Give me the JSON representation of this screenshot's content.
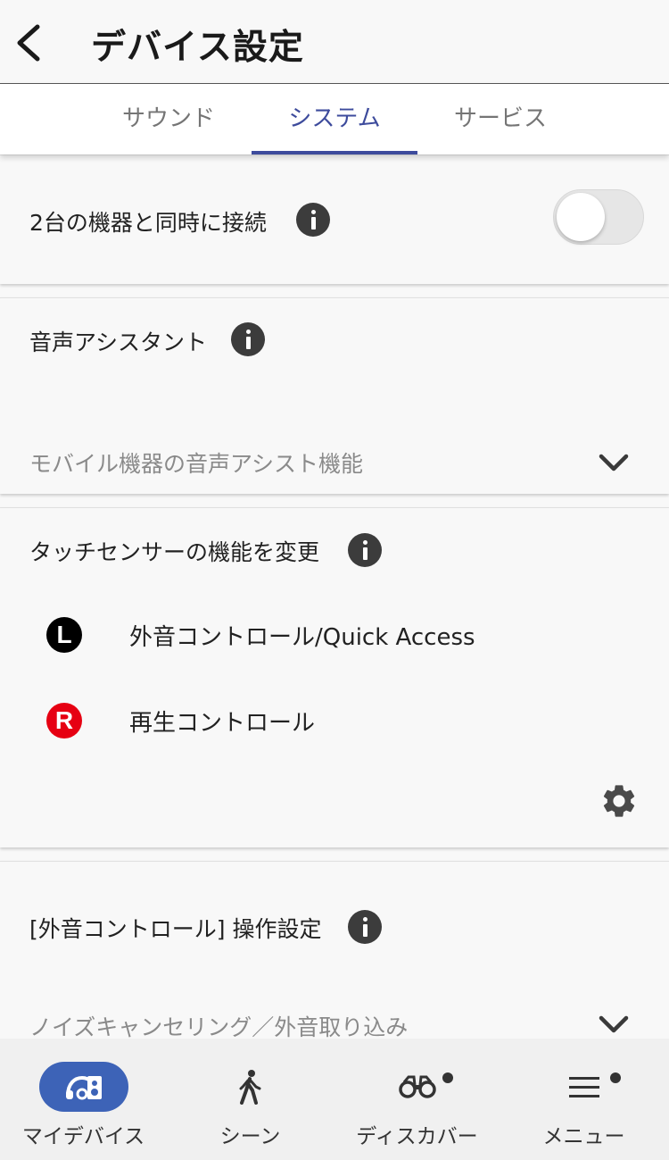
{
  "header": {
    "title": "デバイス設定",
    "back_icon": "chevron-left-icon"
  },
  "tabs": [
    {
      "label": "サウンド",
      "active": false
    },
    {
      "label": "システム",
      "active": true
    },
    {
      "label": "サービス",
      "active": false
    }
  ],
  "sections": {
    "multipoint": {
      "label": "2台の機器と同時に接続",
      "toggle_on": false
    },
    "voice_assistant": {
      "label": "音声アシスタント",
      "selected_value": "モバイル機器の音声アシスト機能"
    },
    "touch_sensor": {
      "label": "タッチセンサーの機能を変更",
      "rows": [
        {
          "badge": "L",
          "text": "外音コントロール/Quick Access"
        },
        {
          "badge": "R",
          "text": "再生コントロール"
        }
      ]
    },
    "ambient_control": {
      "label": "[外音コントロール] 操作設定",
      "selected_value": "ノイズキャンセリング／外音取り込み"
    }
  },
  "bottom_nav": [
    {
      "label": "マイデバイス",
      "icon": "my-device-icon",
      "active": true,
      "badge_dot": false
    },
    {
      "label": "シーン",
      "icon": "walking-person-icon",
      "active": false,
      "badge_dot": false
    },
    {
      "label": "ディスカバー",
      "icon": "binoculars-icon",
      "active": false,
      "badge_dot": true
    },
    {
      "label": "メニュー",
      "icon": "hamburger-menu-icon",
      "active": false,
      "badge_dot": true
    }
  ],
  "colors": {
    "accent": "#3d4b9c",
    "nav_active_pill": "#3d63b7",
    "right_badge": "#e60012",
    "left_badge": "#000000"
  }
}
